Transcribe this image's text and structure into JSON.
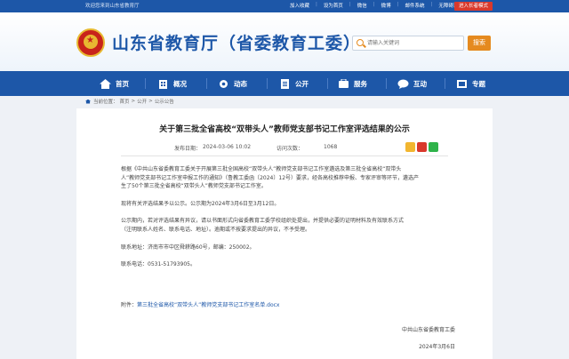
{
  "topbar": {
    "welcome": "欢迎您来到山东省教育厅",
    "links": [
      "加入收藏",
      "设为首页",
      "微信",
      "微博",
      "邮件系统",
      "无障碍浏览"
    ],
    "elder_mode": "进入长者模式"
  },
  "header": {
    "site_title": "山东省教育厅（省委教育工委）",
    "search_placeholder": "请输入关键词",
    "search_button": "搜索"
  },
  "nav": {
    "items": [
      {
        "label": "首页",
        "icon": "home-icon"
      },
      {
        "label": "概况",
        "icon": "building-icon"
      },
      {
        "label": "动态",
        "icon": "gear-icon"
      },
      {
        "label": "公开",
        "icon": "document-icon"
      },
      {
        "label": "服务",
        "icon": "service-icon"
      },
      {
        "label": "互动",
        "icon": "chat-icon"
      },
      {
        "label": "专题",
        "icon": "topic-icon"
      }
    ]
  },
  "breadcrumb": {
    "prefix": "当前位置：",
    "items": [
      "首页",
      "公开",
      "公示公告"
    ]
  },
  "article": {
    "title": "关于第三批全省高校“双带头人”教师党支部书记工作室评选结果的公示",
    "publish_label": "发布日期：",
    "publish_date": "2024-03-06 10:02",
    "views_label": "访问次数：",
    "views": "1068",
    "paragraphs": [
      "根据《中共山东省委教育工委关于开展第三批全国高校“双带头人”教师党支部书记工作室遴选及第三批全省高校“双带头",
      "人”教师党支部书记工作室申报工作的通知》（鲁教工委函〔2024〕12号）要求，经各高校推荐申报、专家评审等环节，遴选产",
      "生了50个第三批全省高校“双带头人”教师党支部书记工作室。",
      "现将有关评选结果予以公示。公示期为2024年3月6日至3月12日。",
      "公示期内，若对评选结果有异议，请以书面形式向省委教育工委学校组织处提出，并提供必要的证明材料及有效联系方式",
      "（注明联系人姓名、联系电话、地址）。逾期或不按要求提出的异议，不予受理。",
      "联系地址：济南市市中区舜耕路60号，邮编：250002。",
      "联系电话：0531-51793905。"
    ],
    "attachment_label": "附件：",
    "attachment_name": "第三批全省高校“双带头人”教师党支部书记工作室名单.docx",
    "signature_org": "中共山东省委教育工委",
    "signature_date": "2024年3月6日"
  },
  "colors": {
    "primary": "#1d57a8",
    "accent_orange": "#e58a1f",
    "elder_red": "#d9392c"
  }
}
